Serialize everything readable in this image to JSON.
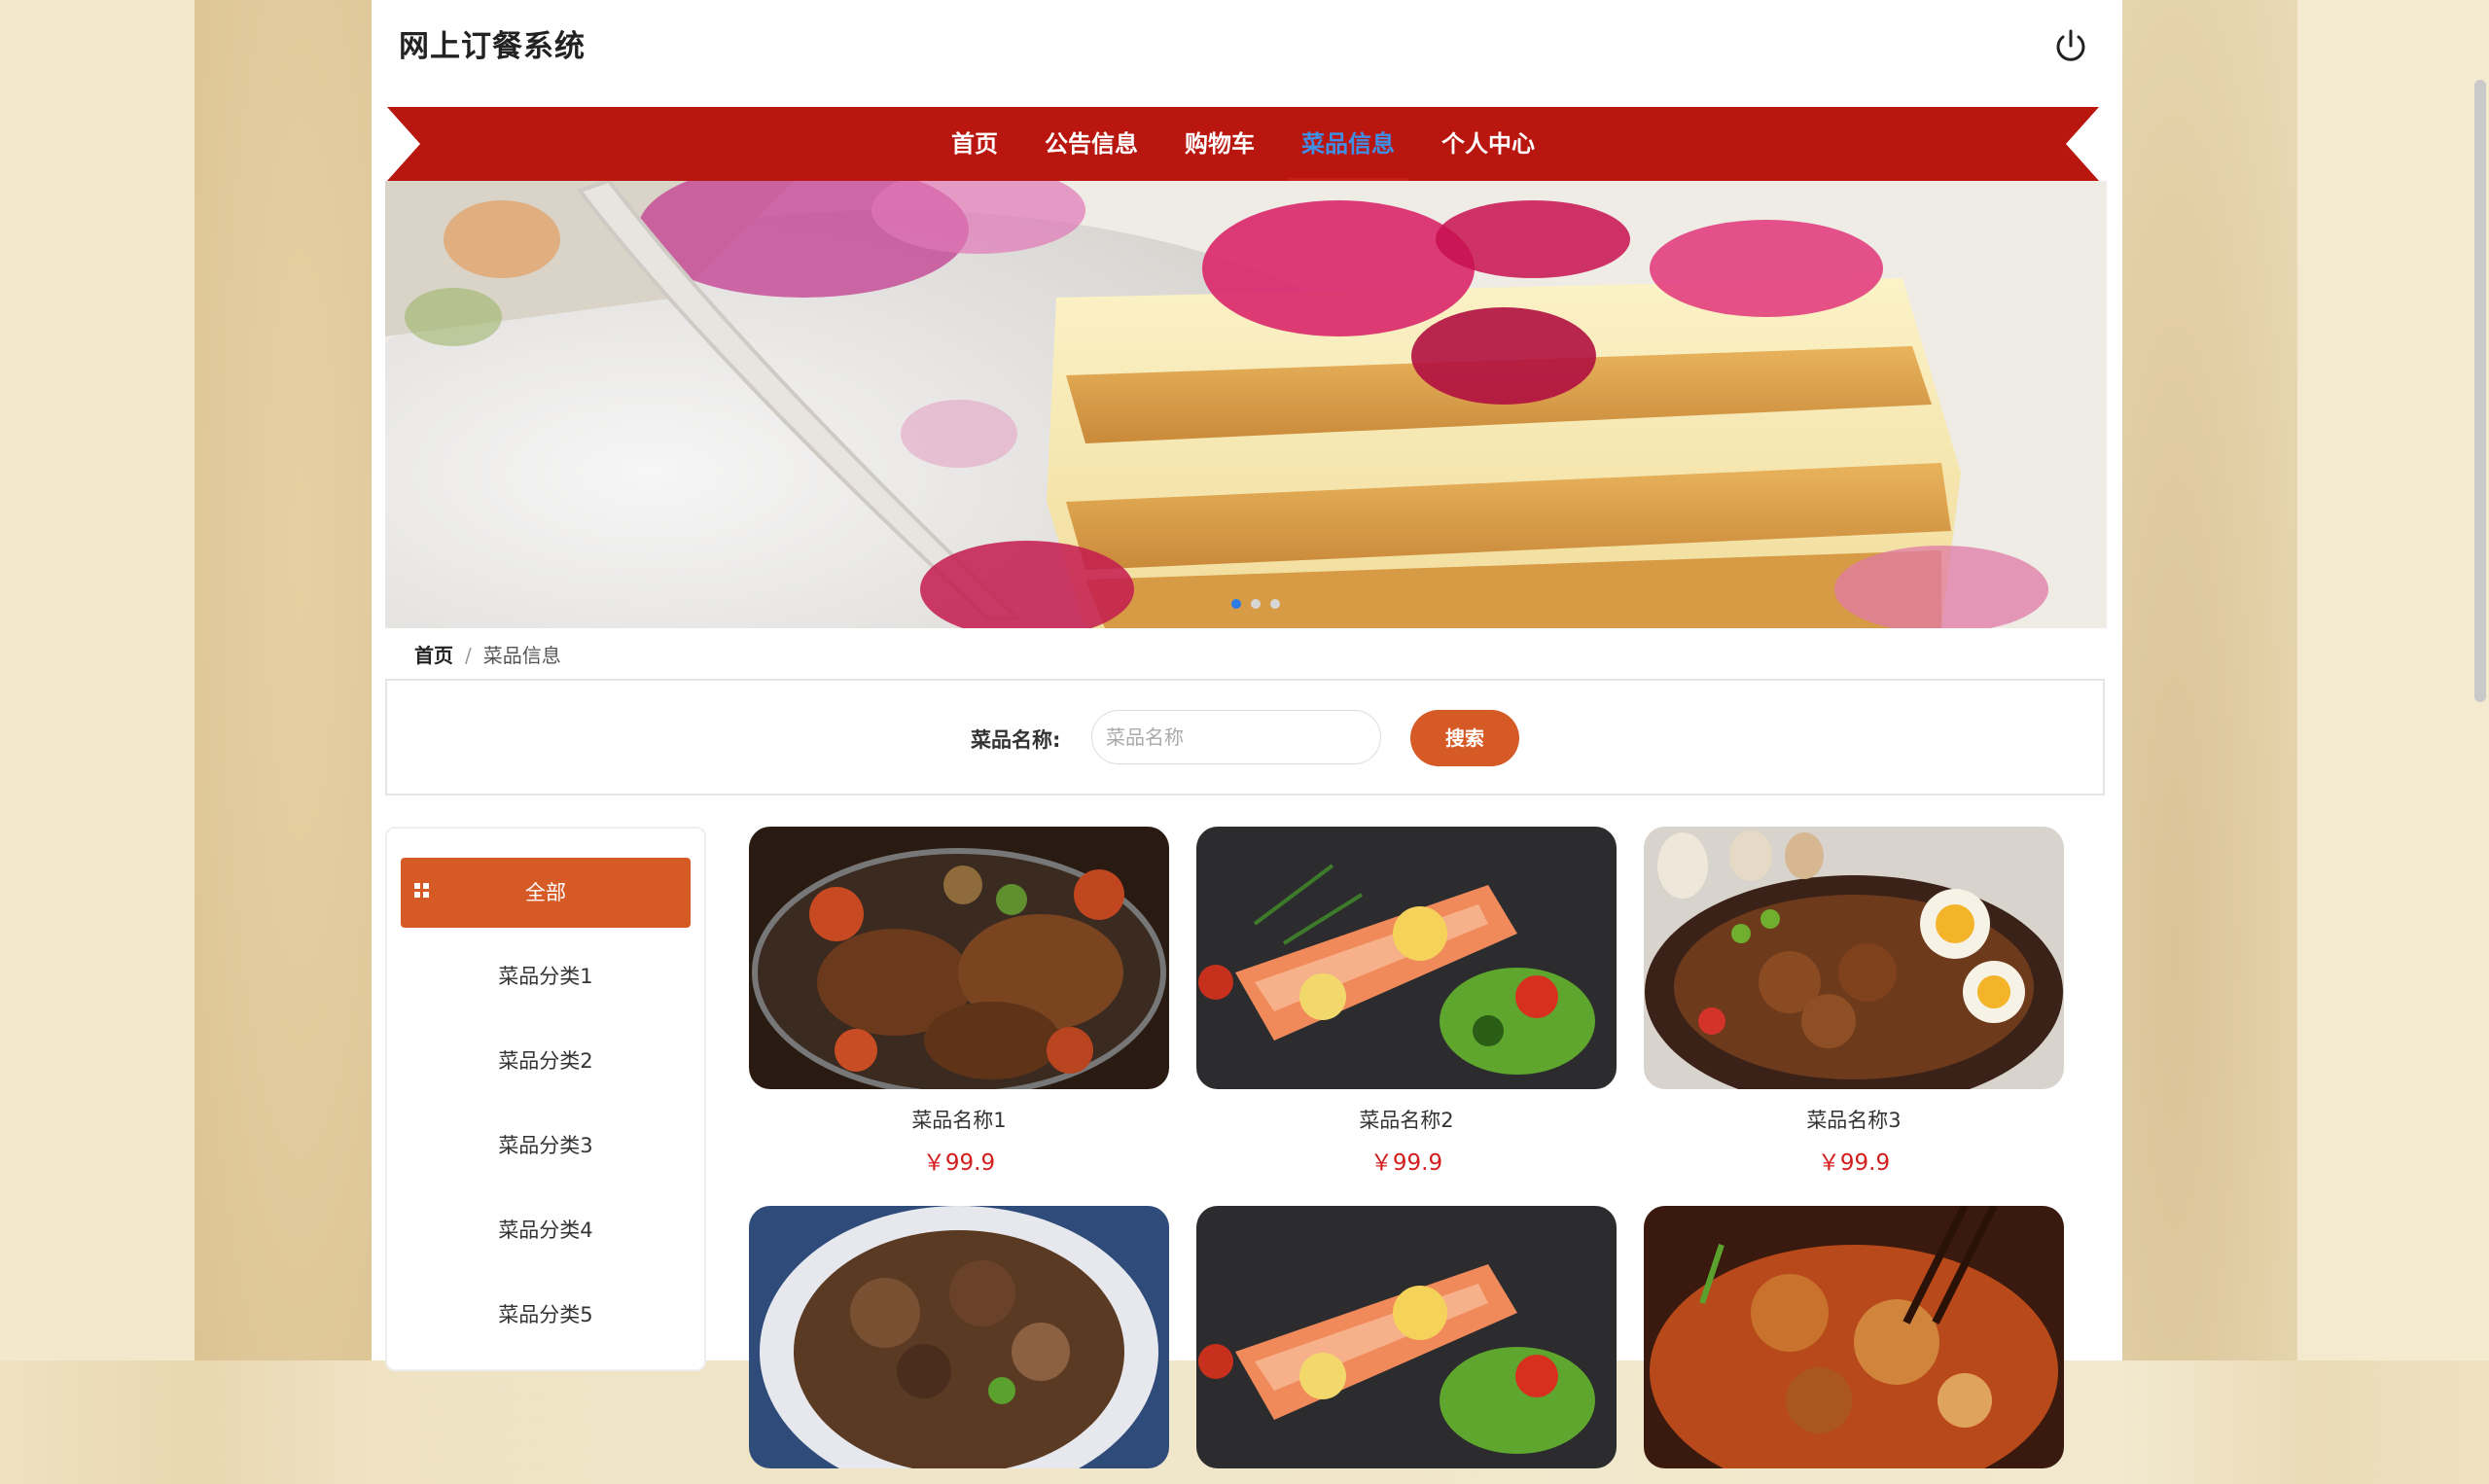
{
  "app": {
    "title": "网上订餐系统"
  },
  "nav": {
    "items": [
      {
        "label": "首页"
      },
      {
        "label": "公告信息"
      },
      {
        "label": "购物车"
      },
      {
        "label": "菜品信息"
      },
      {
        "label": "个人中心"
      }
    ],
    "active_index": 3
  },
  "breadcrumb": {
    "home": "首页",
    "separator": "/",
    "current": "菜品信息"
  },
  "search": {
    "label": "菜品名称:",
    "placeholder": "菜品名称",
    "value": "",
    "button": "搜索"
  },
  "sidebar": {
    "all_label": "全部",
    "items": [
      {
        "label": "菜品分类1"
      },
      {
        "label": "菜品分类2"
      },
      {
        "label": "菜品分类3"
      },
      {
        "label": "菜品分类4"
      },
      {
        "label": "菜品分类5"
      }
    ]
  },
  "dishes": [
    {
      "name": "菜品名称1",
      "price": "￥99.9"
    },
    {
      "name": "菜品名称2",
      "price": "￥99.9"
    },
    {
      "name": "菜品名称3",
      "price": "￥99.9"
    },
    {
      "name": "",
      "price": ""
    },
    {
      "name": "",
      "price": ""
    },
    {
      "name": "",
      "price": ""
    }
  ],
  "banner": {
    "slides": 3,
    "active_slide": 1
  },
  "colors": {
    "accent": "#d65a26",
    "nav_red": "#b8160f",
    "active_link": "#3f8ee8",
    "price": "#d41e1e"
  },
  "icons": {
    "power": "power-icon",
    "category": "grid-icon"
  }
}
